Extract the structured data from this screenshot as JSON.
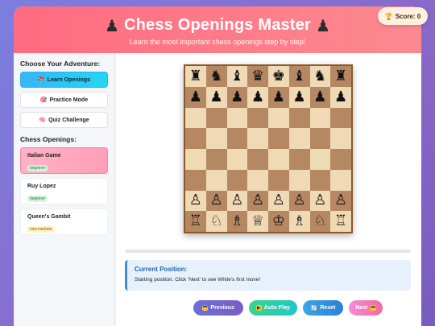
{
  "header": {
    "title": "Chess Openings Master",
    "subtitle": "Learn the most important chess openings step by step!",
    "icon_left": "♟",
    "icon_right": "♟"
  },
  "score": {
    "icon": "🏆",
    "label": "Score: 0"
  },
  "sidebar": {
    "adventure_title": "Choose Your Adventure:",
    "modes": [
      {
        "icon": "📚",
        "label": "Learn Openings",
        "active": true
      },
      {
        "icon": "🎯",
        "label": "Practice Mode",
        "active": false
      },
      {
        "icon": "🧠",
        "label": "Quiz Challenge",
        "active": false
      }
    ],
    "openings_title": "Chess Openings:",
    "openings": [
      {
        "name": "Italian Game",
        "level": "beginner",
        "active": true
      },
      {
        "name": "Ruy Lopez",
        "level": "beginner",
        "active": false
      },
      {
        "name": "Queen's Gambit",
        "level": "intermediate",
        "active": false
      }
    ]
  },
  "board": {
    "rows": [
      [
        "♜",
        "♞",
        "♝",
        "♛",
        "♚",
        "♝",
        "♞",
        "♜"
      ],
      [
        "♟",
        "♟",
        "♟",
        "♟",
        "♟",
        "♟",
        "♟",
        "♟"
      ],
      [
        "",
        "",
        "",
        "",
        "",
        "",
        "",
        ""
      ],
      [
        "",
        "",
        "",
        "",
        "",
        "",
        "",
        ""
      ],
      [
        "",
        "",
        "",
        "",
        "",
        "",
        "",
        ""
      ],
      [
        "",
        "",
        "",
        "",
        "",
        "",
        "",
        ""
      ],
      [
        "♙",
        "♙",
        "♙",
        "♙",
        "♙",
        "♙",
        "♙",
        "♙"
      ],
      [
        "♖",
        "♘",
        "♗",
        "♕",
        "♔",
        "♗",
        "♘",
        "♖"
      ]
    ],
    "progress": 0
  },
  "position": {
    "title": "Current Position:",
    "description": "Starting position. Click 'Next' to see White's first move!"
  },
  "controls": {
    "previous": "Previous",
    "auto_play": "Auto Play",
    "reset": "Reset",
    "next": "Next",
    "previous_icon": "⏮",
    "auto_icon": "▶",
    "reset_icon": "🔄",
    "next_icon": "⏭"
  }
}
